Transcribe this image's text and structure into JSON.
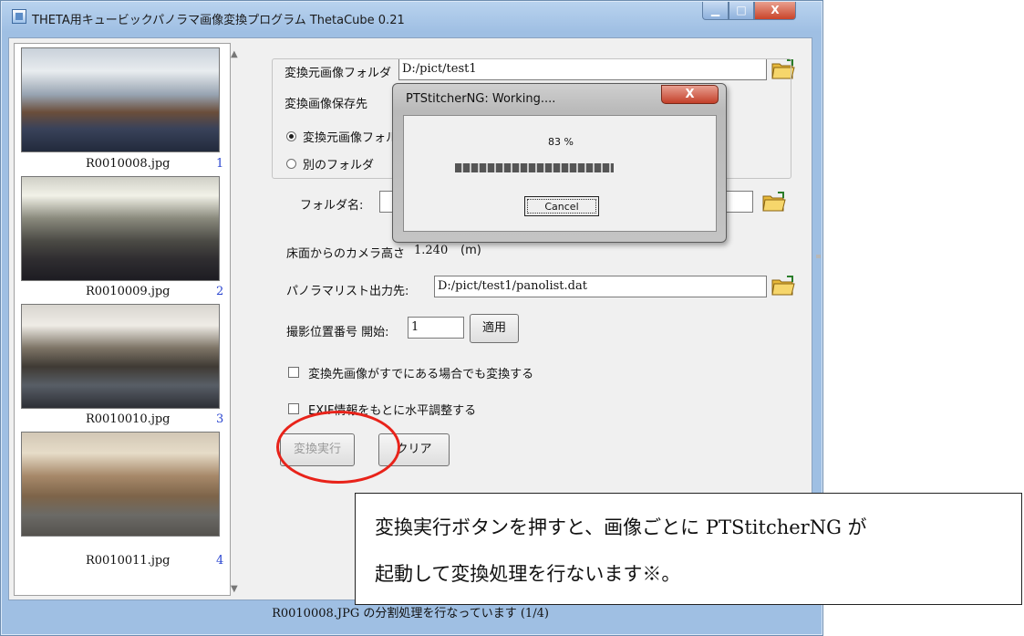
{
  "window": {
    "title": "THETA用キュービックパノラマ画像変換プログラム ThetaCube 0.21",
    "minimize": "▁",
    "maximize": "□",
    "close": "X"
  },
  "thumbnails": [
    {
      "filename": "R0010008.jpg",
      "index": "1"
    },
    {
      "filename": "R0010009.jpg",
      "index": "2"
    },
    {
      "filename": "R0010010.jpg",
      "index": "3"
    },
    {
      "filename": "R0010011.jpg",
      "index": "4"
    }
  ],
  "form": {
    "source_folder_label": "変換元画像フォルダ",
    "source_folder_value": "D:/pict/test1",
    "save_group_label": "変換画像保存先",
    "radio_same_label": "変換元画像フォルダ",
    "radio_other_label": "別のフォルダ",
    "folder_name_label": "フォルダ名:",
    "camera_height_label": "床面からのカメラ高さ",
    "camera_height_value": "1.240",
    "camera_height_unit": "(m)",
    "panolist_label": "パノラマリスト出力先:",
    "panolist_value": "D:/pict/test1/panolist.dat",
    "position_label": "撮影位置番号 開始:",
    "position_value": "1",
    "apply_button": "適用",
    "overwrite_check_label": "変換先画像がすでにある場合でも変換する",
    "exif_check_label": "EXIF情報をもとに水平調整する",
    "execute_button": "変換実行",
    "clear_button": "クリア"
  },
  "status": "R0010008.JPG の分割処理を行なっています (1/4)",
  "dialog": {
    "title": "PTStitcherNG: Working....",
    "close": "X",
    "progress_text": "83 %",
    "progress": 0.83,
    "cancel_button": "Cancel"
  },
  "annotation": {
    "line1": "変換実行ボタンを押すと、画像ごとに PTStitcherNG が",
    "line2": "起動して変換処理を行ないます※。"
  },
  "colors": {
    "highlight_circle": "#e8231a",
    "thumbnail_index": "#2a45d0"
  }
}
